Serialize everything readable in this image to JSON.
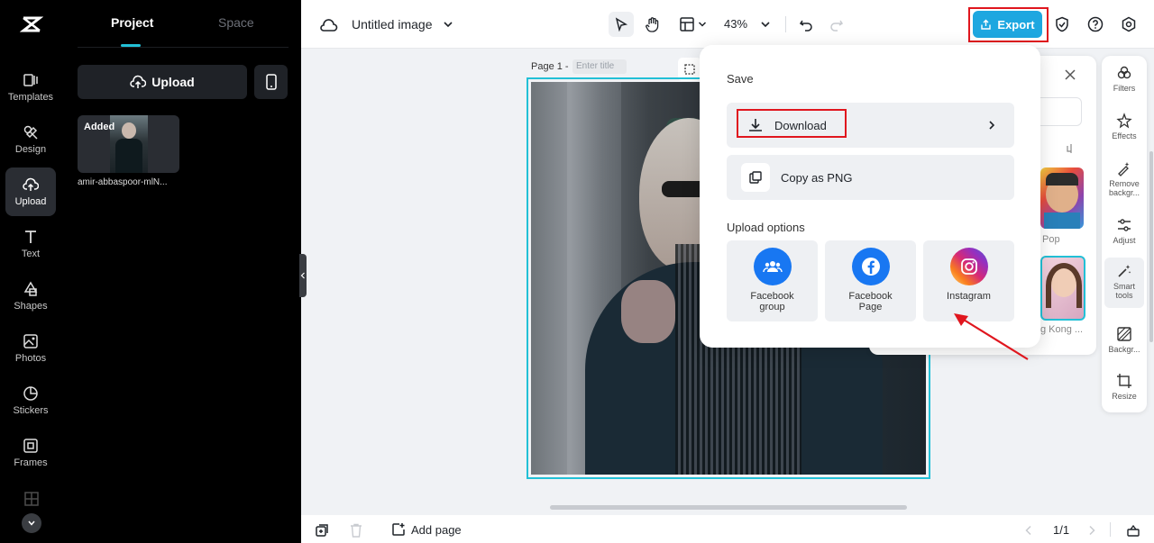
{
  "rail": {
    "items": [
      {
        "label": "Templates"
      },
      {
        "label": "Design"
      },
      {
        "label": "Upload"
      },
      {
        "label": "Text"
      },
      {
        "label": "Shapes"
      },
      {
        "label": "Photos"
      },
      {
        "label": "Stickers"
      },
      {
        "label": "Frames"
      }
    ]
  },
  "panel": {
    "tab_project": "Project",
    "tab_space": "Space",
    "upload_label": "Upload",
    "thumb_badge": "Added",
    "thumb_name": "amir-abbaspoor-mlN..."
  },
  "topbar": {
    "title": "Untitled image",
    "zoom": "43%",
    "export_label": "Export"
  },
  "canvas": {
    "page_label": "Page 1 -",
    "title_placeholder": "Enter title"
  },
  "export_popup": {
    "save_heading": "Save",
    "download_label": "Download",
    "copy_label": "Copy as PNG",
    "upload_heading": "Upload options",
    "options": [
      {
        "line1": "Facebook",
        "line2": "group"
      },
      {
        "line1": "Facebook",
        "line2": "Page"
      },
      {
        "line1": "Instagram",
        "line2": ""
      }
    ]
  },
  "side_cards": {
    "pop_label": "Pop",
    "kong_label": "g Kong ..."
  },
  "right_tools": [
    {
      "line1": "Filters",
      "line2": ""
    },
    {
      "line1": "Effects",
      "line2": ""
    },
    {
      "line1": "Remove",
      "line2": "backgr..."
    },
    {
      "line1": "Adjust",
      "line2": ""
    },
    {
      "line1": "Smart",
      "line2": "tools"
    },
    {
      "line1": "Backgr...",
      "line2": ""
    },
    {
      "line1": "Resize",
      "line2": ""
    }
  ],
  "bottom": {
    "add_page": "Add page",
    "page_count": "1/1"
  },
  "colors": {
    "accent": "#00bcd4",
    "highlight": "#e0161e",
    "export_bg": "#1ea7e0"
  }
}
